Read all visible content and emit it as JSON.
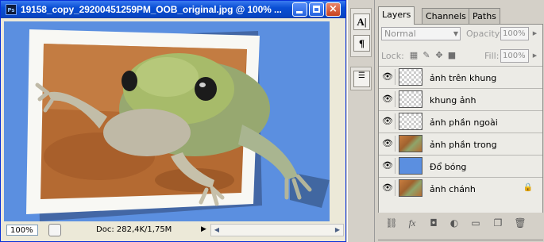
{
  "document": {
    "title": "19158_copy_29200451259PM_OOB_original.jpg @ 100% ...",
    "app_icon_text": "Ps",
    "zoom": "100%",
    "doc_info": "Doc: 282,4K/1,75M"
  },
  "toolstrip": {
    "char_glyph": "A|",
    "para_glyph": "¶"
  },
  "layers_panel": {
    "tabs": [
      "Layers",
      "Channels",
      "Paths"
    ],
    "blend_mode": "Normal",
    "opacity_label": "Opacity:",
    "opacity_value": "100%",
    "lock_label": "Lock:",
    "fill_label": "Fill:",
    "fill_value": "100%",
    "layers": [
      {
        "name": "ảnh trên khung",
        "thumb": "transparent",
        "visible": true,
        "locked": false
      },
      {
        "name": "khung ảnh",
        "thumb": "transparent",
        "visible": true,
        "locked": false
      },
      {
        "name": "ảnh phần ngoài",
        "thumb": "transparent",
        "visible": true,
        "locked": false
      },
      {
        "name": "ảnh phần trong",
        "thumb": "frog",
        "visible": true,
        "locked": false
      },
      {
        "name": "Đổ bóng",
        "thumb": "blue",
        "visible": true,
        "locked": false
      },
      {
        "name": "ảnh chánh",
        "thumb": "frog",
        "visible": true,
        "locked": true
      }
    ],
    "footer_icons": [
      "link-icon",
      "fx-icon",
      "mask-icon",
      "adjustment-icon",
      "group-folder-icon",
      "new-layer-icon",
      "trash-icon"
    ],
    "footer_fx": "fx"
  },
  "colors": {
    "canvas_bg": "#5b8fe0",
    "titlebar": "#0a4fd4"
  }
}
